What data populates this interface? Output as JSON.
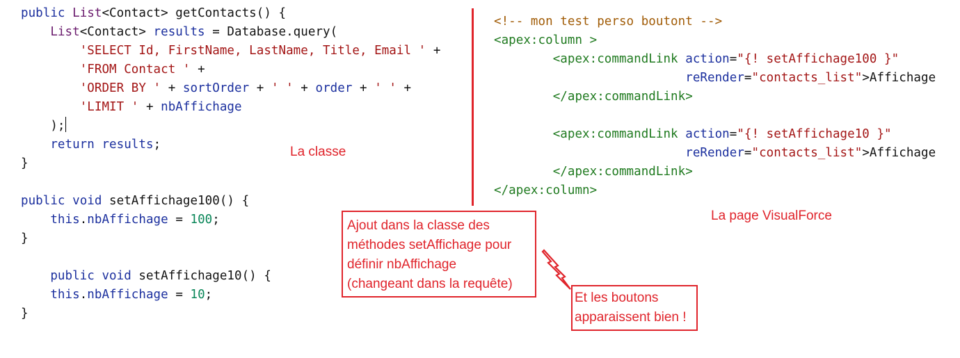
{
  "class_code": {
    "lines": [
      [
        {
          "t": "public ",
          "c": "kw"
        },
        {
          "t": "List",
          "c": "ty"
        },
        {
          "t": "<Contact> getContacts() {",
          "c": "pl"
        }
      ],
      [
        {
          "t": "    ",
          "c": "pl"
        },
        {
          "t": "List",
          "c": "ty"
        },
        {
          "t": "<Contact> ",
          "c": "pl"
        },
        {
          "t": "results",
          "c": "kw"
        },
        {
          "t": " = Database.query(",
          "c": "pl"
        }
      ],
      [
        {
          "t": "        ",
          "c": "pl"
        },
        {
          "t": "'SELECT Id, FirstName, LastName, Title, Email '",
          "c": "str"
        },
        {
          "t": " +",
          "c": "pl"
        }
      ],
      [
        {
          "t": "        ",
          "c": "pl"
        },
        {
          "t": "'FROM Contact '",
          "c": "str"
        },
        {
          "t": " +",
          "c": "pl"
        }
      ],
      [
        {
          "t": "        ",
          "c": "pl"
        },
        {
          "t": "'ORDER BY '",
          "c": "str"
        },
        {
          "t": " + ",
          "c": "pl"
        },
        {
          "t": "sortOrder",
          "c": "kw"
        },
        {
          "t": " + ",
          "c": "pl"
        },
        {
          "t": "' '",
          "c": "str"
        },
        {
          "t": " + ",
          "c": "pl"
        },
        {
          "t": "order",
          "c": "kw"
        },
        {
          "t": " + ",
          "c": "pl"
        },
        {
          "t": "' '",
          "c": "str"
        },
        {
          "t": " +",
          "c": "pl"
        }
      ],
      [
        {
          "t": "        ",
          "c": "pl"
        },
        {
          "t": "'LIMIT '",
          "c": "str"
        },
        {
          "t": " + ",
          "c": "pl"
        },
        {
          "t": "nbAffichage",
          "c": "kw"
        }
      ],
      [
        {
          "t": "    );",
          "c": "pl"
        },
        {
          "t": "",
          "c": "caret"
        }
      ],
      [
        {
          "t": "    ",
          "c": "pl"
        },
        {
          "t": "return",
          "c": "kw"
        },
        {
          "t": " ",
          "c": "pl"
        },
        {
          "t": "results",
          "c": "kw"
        },
        {
          "t": ";",
          "c": "pl"
        }
      ],
      [
        {
          "t": "}",
          "c": "pl"
        }
      ],
      [
        {
          "t": "",
          "c": "pl"
        }
      ],
      [
        {
          "t": "public ",
          "c": "kw"
        },
        {
          "t": "void",
          "c": "kw"
        },
        {
          "t": " setAffichage100() {",
          "c": "pl"
        }
      ],
      [
        {
          "t": "    ",
          "c": "pl"
        },
        {
          "t": "this",
          "c": "kw"
        },
        {
          "t": ".",
          "c": "pl"
        },
        {
          "t": "nbAffichage",
          "c": "kw"
        },
        {
          "t": " = ",
          "c": "pl"
        },
        {
          "t": "100",
          "c": "num"
        },
        {
          "t": ";",
          "c": "pl"
        }
      ],
      [
        {
          "t": "}",
          "c": "pl"
        }
      ],
      [
        {
          "t": "",
          "c": "pl"
        }
      ],
      [
        {
          "t": "    ",
          "c": "pl"
        },
        {
          "t": "public ",
          "c": "kw"
        },
        {
          "t": "void",
          "c": "kw"
        },
        {
          "t": " setAffichage10() {",
          "c": "pl"
        }
      ],
      [
        {
          "t": "    ",
          "c": "pl"
        },
        {
          "t": "this",
          "c": "kw"
        },
        {
          "t": ".",
          "c": "pl"
        },
        {
          "t": "nbAffichage",
          "c": "kw"
        },
        {
          "t": " = ",
          "c": "pl"
        },
        {
          "t": "10",
          "c": "num"
        },
        {
          "t": ";",
          "c": "pl"
        }
      ],
      [
        {
          "t": "}",
          "c": "pl"
        }
      ]
    ]
  },
  "page_code": {
    "lines": [
      [
        {
          "t": "<!-- mon test perso boutont -->",
          "c": "cmt"
        }
      ],
      [
        {
          "t": "<apex:column >",
          "c": "tag"
        }
      ],
      [
        {
          "t": "        ",
          "c": "pl"
        },
        {
          "t": "<apex:commandLink ",
          "c": "tag"
        },
        {
          "t": "action",
          "c": "attr"
        },
        {
          "t": "=",
          "c": "pl"
        },
        {
          "t": "\"{! setAffichage100 }\"",
          "c": "aval"
        }
      ],
      [
        {
          "t": "                          ",
          "c": "pl"
        },
        {
          "t": "reRender",
          "c": "attr"
        },
        {
          "t": "=",
          "c": "pl"
        },
        {
          "t": "\"contacts_list\"",
          "c": "aval"
        },
        {
          "t": ">Affichage",
          "c": "pl"
        }
      ],
      [
        {
          "t": "        ",
          "c": "pl"
        },
        {
          "t": "</apex:commandLink>",
          "c": "tag"
        }
      ],
      [
        {
          "t": "",
          "c": "pl"
        }
      ],
      [
        {
          "t": "        ",
          "c": "pl"
        },
        {
          "t": "<apex:commandLink ",
          "c": "tag"
        },
        {
          "t": "action",
          "c": "attr"
        },
        {
          "t": "=",
          "c": "pl"
        },
        {
          "t": "\"{! setAffichage10 }\"",
          "c": "aval"
        }
      ],
      [
        {
          "t": "                          ",
          "c": "pl"
        },
        {
          "t": "reRender",
          "c": "attr"
        },
        {
          "t": "=",
          "c": "pl"
        },
        {
          "t": "\"contacts_list\"",
          "c": "aval"
        },
        {
          "t": ">Affichage",
          "c": "pl"
        }
      ],
      [
        {
          "t": "        ",
          "c": "pl"
        },
        {
          "t": "</apex:commandLink>",
          "c": "tag"
        }
      ],
      [
        {
          "t": "</apex:column>",
          "c": "tag"
        }
      ]
    ]
  },
  "labels": {
    "classe": "La classe",
    "visualforce": "La page VisualForce"
  },
  "notes": {
    "ajout": [
      "Ajout dans la classe des",
      "méthodes setAffichage pour",
      "définir nbAffichage",
      "(changeant dans la requête)"
    ],
    "boutons": [
      "Et les boutons",
      "apparaissent bien !"
    ]
  },
  "colors": {
    "annotation_red": "#e0242b",
    "keyword_blue": "#1b2f9e",
    "string_red": "#a31515",
    "type_purple": "#6a1b6d",
    "number_green": "#098658",
    "tag_green": "#1f7a1f",
    "comment_brown": "#a15c07"
  },
  "icons": {
    "bolt": "lightning-bolt-icon"
  }
}
